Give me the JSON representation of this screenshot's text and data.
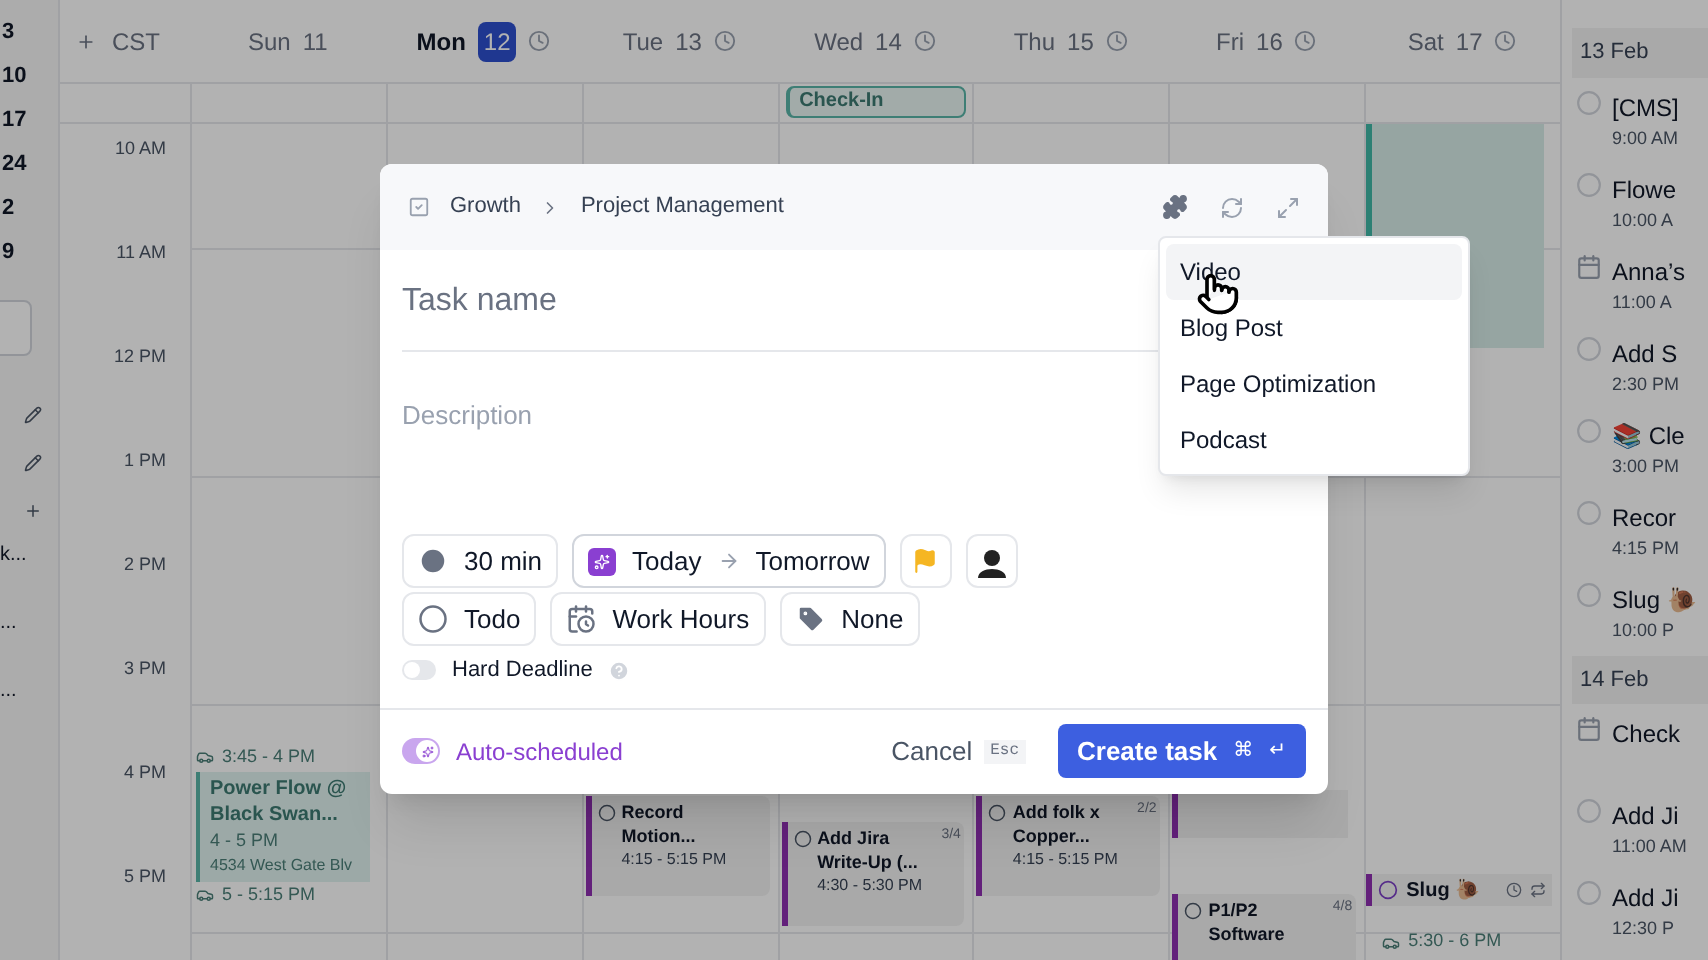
{
  "mini_calendar": {
    "dates": [
      "3",
      "10",
      "17",
      "24",
      "2",
      "9"
    ],
    "items": [
      "k...",
      "...",
      "..."
    ]
  },
  "calendar": {
    "timezone": "CST",
    "all_day": [
      {
        "title": "Check-In"
      }
    ],
    "hours": [
      "10 AM",
      "11 AM",
      "12 PM",
      "1 PM",
      "2 PM",
      "3 PM",
      "4 PM",
      "5 PM"
    ],
    "days": [
      {
        "name": "Sun",
        "date": "11",
        "selected": false,
        "events": [
          {
            "kind": "appointment",
            "before": "3:45 - 4 PM",
            "title": "Power Flow @ Black Swan...",
            "time": "4 - 5 PM",
            "location": "4534 West Gate Blv",
            "after": "5 - 5:15 PM"
          }
        ]
      },
      {
        "name": "Mon",
        "date": "12",
        "selected": true
      },
      {
        "name": "Tue",
        "date": "13",
        "selected": false,
        "events": [
          {
            "kind": "task",
            "title": "Record Motion...",
            "time": "4:15 - 5:15 PM"
          }
        ]
      },
      {
        "name": "Wed",
        "date": "14",
        "selected": false,
        "events": [
          {
            "kind": "task",
            "title": "Add Jira Write-Up (...",
            "time": "4:30 - 5:30 PM",
            "progress": "3/4"
          }
        ]
      },
      {
        "name": "Thu",
        "date": "15",
        "selected": false,
        "events": [
          {
            "kind": "task",
            "title": "Add folk x Copper...",
            "time": "4:15 - 5:15 PM",
            "progress": "2/2"
          }
        ]
      },
      {
        "name": "Fri",
        "date": "16",
        "selected": false,
        "events": [
          {
            "kind": "block"
          },
          {
            "kind": "task",
            "title": "P1/P2 Software",
            "progress": "4/8"
          }
        ]
      },
      {
        "name": "Sat",
        "date": "17",
        "selected": false,
        "events": [
          {
            "kind": "focus"
          },
          {
            "kind": "habit",
            "title": "Slug 🐌"
          },
          {
            "kind": "travel",
            "time": "5:30 - 6 PM"
          }
        ]
      }
    ]
  },
  "task_list": {
    "groups": [
      {
        "date": "13 Feb",
        "items": [
          {
            "kind": "task",
            "title": "[CMS]",
            "time": "9:00 AM"
          },
          {
            "kind": "task",
            "title": "Flowe",
            "time": "10:00 A"
          },
          {
            "kind": "event",
            "title": "Anna’s",
            "time": "11:00 A"
          },
          {
            "kind": "task",
            "title": "Add S",
            "time": "2:30 PM"
          },
          {
            "kind": "task",
            "title": "📚 Cle",
            "time": "3:00 PM"
          },
          {
            "kind": "task",
            "title": "Recor",
            "time": "4:15 PM"
          },
          {
            "kind": "task",
            "title": "Slug 🐌",
            "time": "10:00 P"
          }
        ]
      },
      {
        "date": "14 Feb",
        "items": [
          {
            "kind": "event",
            "title": "Check"
          },
          {
            "kind": "task",
            "title": "Add Ji",
            "time": "11:00 AM"
          },
          {
            "kind": "task",
            "title": "Add Ji",
            "time": "12:30 P"
          }
        ]
      }
    ]
  },
  "task_modal": {
    "breadcrumb": [
      "Growth",
      "Project Management"
    ],
    "name_placeholder": "Task name",
    "description_placeholder": "Description",
    "duration": "30 min",
    "start": "Today",
    "due": "Tomorrow",
    "status": "Todo",
    "schedule": "Work Hours",
    "label": "None",
    "hard_deadline": {
      "label": "Hard Deadline",
      "on": false
    },
    "auto_scheduled": {
      "label": "Auto-scheduled",
      "on": true
    },
    "cancel": "Cancel",
    "cancel_key": "Esc",
    "submit": "Create task",
    "submit_keys": [
      "⌘",
      "↵"
    ]
  },
  "template_menu": {
    "items": [
      {
        "label": "Video",
        "selected": true
      },
      {
        "label": "Blog Post",
        "selected": false
      },
      {
        "label": "Page Optimization",
        "selected": false
      },
      {
        "label": "Podcast",
        "selected": false
      }
    ]
  }
}
